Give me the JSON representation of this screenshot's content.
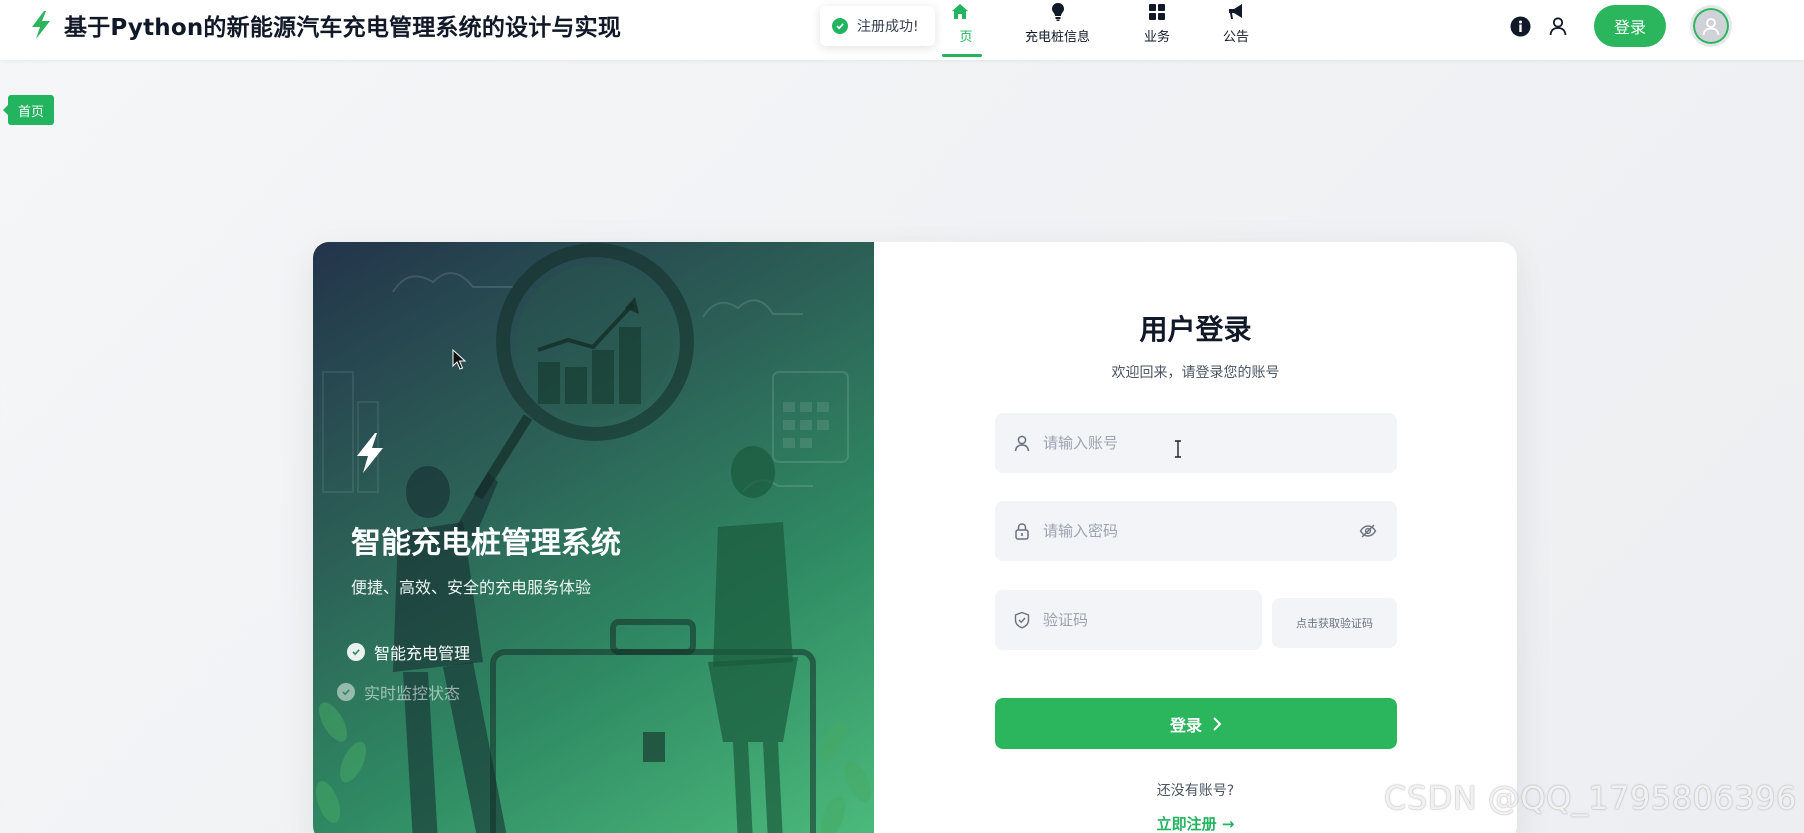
{
  "header": {
    "title": "基于Python的新能源汽车充电管理系统的设计与实现",
    "nav": [
      {
        "label": "页",
        "icon": "home-icon",
        "active": true
      },
      {
        "label": "充电桩信息",
        "icon": "lightbulb-icon",
        "active": false
      },
      {
        "label": "业务",
        "icon": "grid-icon",
        "active": false
      },
      {
        "label": "公告",
        "icon": "megaphone-icon",
        "active": false
      }
    ],
    "login_label": "登录"
  },
  "toast": {
    "message": "注册成功!"
  },
  "breadcrumb": {
    "tag": "首页"
  },
  "left_panel": {
    "title": "智能充电桩管理系统",
    "subtitle": "便捷、高效、安全的充电服务体验",
    "features": [
      "智能充电管理",
      "实时监控状态"
    ]
  },
  "form": {
    "title": "用户登录",
    "subtitle": "欢迎回来，请登录您的账号",
    "username_placeholder": "请输入账号",
    "password_placeholder": "请输入密码",
    "code_placeholder": "验证码",
    "code_button": "点击获取验证码",
    "submit_label": "登录",
    "no_account": "还没有账号?",
    "register_link": "立即注册"
  },
  "watermark": "CSDN @QQ_1795806396",
  "colors": {
    "accent": "#2bb55c",
    "panel_dark": "#23344b",
    "panel_light": "#4cbb7c"
  }
}
